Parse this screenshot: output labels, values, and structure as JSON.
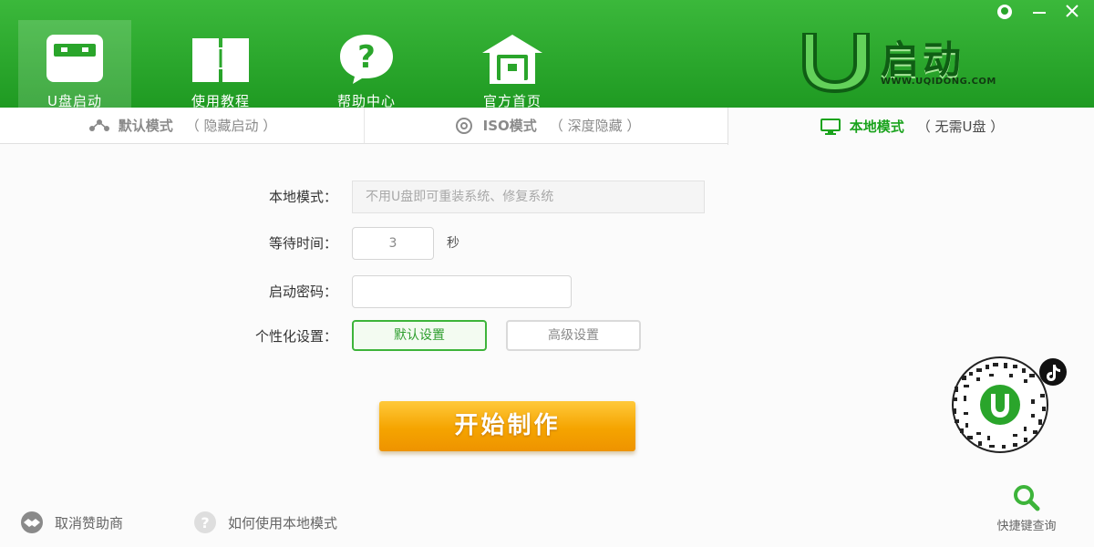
{
  "nav": {
    "items": [
      {
        "label": "U盘启动",
        "icon": "usb-drive-icon"
      },
      {
        "label": "使用教程",
        "icon": "book-icon"
      },
      {
        "label": "帮助中心",
        "icon": "help-icon"
      },
      {
        "label": "官方首页",
        "icon": "home-icon"
      }
    ],
    "active_index": 0
  },
  "logo": {
    "text": "启动",
    "url": "WWW.UQIDONG.COM"
  },
  "tabs": [
    {
      "label": "默认模式",
      "sub": "（ 隐藏启动 ）",
      "icon": "share-nodes-icon"
    },
    {
      "label": "ISO模式",
      "sub": "（ 深度隐藏 ）",
      "icon": "disc-icon"
    },
    {
      "label": "本地模式",
      "sub": "（ 无需U盘 ）",
      "icon": "monitor-icon"
    }
  ],
  "active_tab": 2,
  "form": {
    "mode_label": "本地模式：",
    "mode_placeholder": "不用U盘即可重装系统、修复系统",
    "wait_label": "等待时间：",
    "wait_value": "3",
    "wait_unit": "秒",
    "pwd_label": "启动密码：",
    "pwd_value": "",
    "custom_label": "个性化设置：",
    "default_settings": "默认设置",
    "advanced_settings": "高级设置"
  },
  "start_button": "开始制作",
  "footer": {
    "cancel_sponsor": "取消赞助商",
    "howto_local": "如何使用本地模式",
    "shortcut_query": "快捷键查询"
  },
  "colors": {
    "brand_green": "#1f9a22",
    "accent_orange": "#f5a400",
    "active_tab_text": "#1aa31d"
  }
}
